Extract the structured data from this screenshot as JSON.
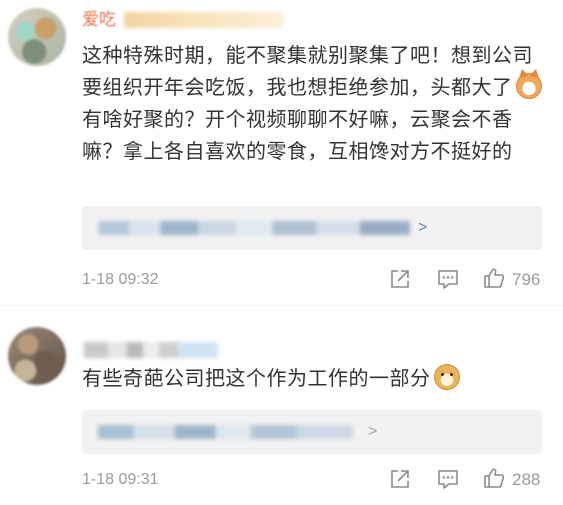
{
  "colors": {
    "username": "#eb7350",
    "body_text": "#333333",
    "meta_text": "#9a9a9a",
    "quote_bg": "#f2f2f2",
    "link_chevron": "#5d87b4"
  },
  "comments": [
    {
      "username_visible": "爱吃",
      "text_part1": "这种特殊时期，能不聚集就别聚集了吧！想到公司要组织开年会吃饭，我也想拒绝参加，头都大了",
      "emoji_1": "cat-face-emoji",
      "text_part2": "有啥好聚的？开个视频聊聊不好嘛，云聚会不香嘛？拿上各自喜欢的零食，互相馋对方不挺好的",
      "quoted_chevron": ">",
      "timestamp": "1-18 09:32",
      "likes": "796",
      "icons": [
        "share-icon",
        "comment-icon",
        "like-icon"
      ]
    },
    {
      "username_visible": "",
      "text_part1": "有些奇葩公司把这个作为工作的一部分",
      "emoji_1": "doge-face-emoji",
      "quoted_chevron": ">",
      "timestamp": "1-18 09:31",
      "likes": "288",
      "icons": [
        "share-icon",
        "comment-icon",
        "like-icon"
      ]
    }
  ]
}
